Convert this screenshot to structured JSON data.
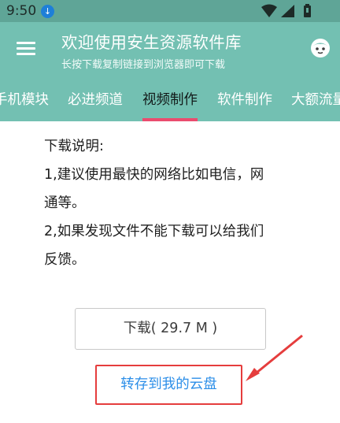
{
  "status_bar": {
    "time": "9:50",
    "download_icon": "download-icon",
    "icons": [
      "wifi-icon",
      "signal-icon",
      "battery-icon"
    ]
  },
  "header": {
    "title": "欢迎使用安生资源软件库",
    "subtitle": "长按下载复制链接到浏览器即可下载",
    "menu_icon": "menu-icon",
    "face_icon": "face-icon"
  },
  "tabs": [
    {
      "label": "手机模块",
      "active": false
    },
    {
      "label": "必进频道",
      "active": false
    },
    {
      "label": "视频制作",
      "active": true
    },
    {
      "label": "软件制作",
      "active": false
    },
    {
      "label": "大额流量",
      "active": false
    }
  ],
  "notes": [
    "下载说明:",
    "1,建议使用最快的网络比如电信，网",
    "通等。",
    "2,如果发现文件不能下载可以给我们",
    "反馈。"
  ],
  "download_button": "下载( 29.7 M )",
  "cloud_button": "转存到我的云盘",
  "colors": {
    "header": "#73c0b2",
    "status_bar": "#5fa597",
    "tab_indicator": "#ea4c6e",
    "cloud_text": "#2b8ee8",
    "annotation_red": "#e53d3d"
  }
}
